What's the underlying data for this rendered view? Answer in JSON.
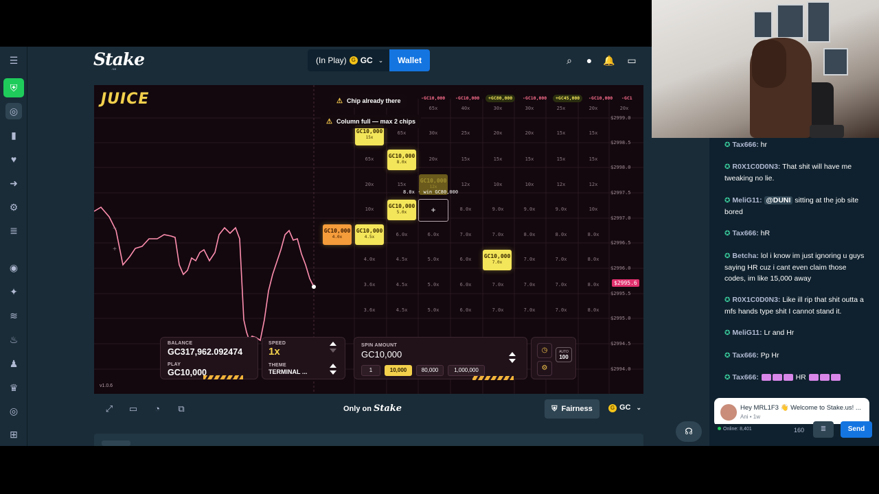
{
  "header": {
    "logo": "Stake",
    "logo_sub": ".us",
    "in_play_label": "(In Play)",
    "currency": "GC",
    "wallet_label": "Wallet"
  },
  "game": {
    "title": "JUICE",
    "version": "v1.0.6",
    "toasts": [
      "Chip already there",
      "Column full — max 2 chips"
    ],
    "hover_win_label": "8.0x · win GC80,000",
    "selected_symbol": "+",
    "trade_pills": [
      "-GC10,000",
      "-GC10,000",
      "+GC80,000",
      "-GC10,000",
      "+GC45,000",
      "-GC10,000",
      "-GC1"
    ],
    "trade_pill_colors": [
      "#ff6f8f",
      "#ff6f8f",
      "#f4e65a",
      "#ff6f8f",
      "#f4e65a",
      "#ff6f8f",
      "#ff6f8f"
    ],
    "prices": [
      "$2999.0",
      "$2998.5",
      "$2998.0",
      "$2997.5",
      "$2997.0",
      "$2996.5",
      "$2996.0",
      "$2995.5",
      "$2995.0",
      "$2994.5",
      "$2994.0"
    ],
    "current_price": "$2995.6",
    "multiplier_rows": [
      [
        "65x",
        "40x",
        "30x",
        "30x",
        "25x",
        "20x",
        "20x"
      ],
      [
        "65x",
        "30x",
        "25x",
        "20x",
        "20x",
        "15x",
        "15x"
      ],
      [
        "65x",
        "20x",
        "15x",
        "15x",
        "15x",
        "15x",
        "15x"
      ],
      [
        "20x",
        "15x",
        "12x",
        "12x",
        "10x",
        "10x",
        "12x"
      ],
      [
        "10x",
        "8.0x",
        "8.0x",
        "9.0x",
        "9.0x",
        "9.0x",
        "10x"
      ],
      [
        "6.0x",
        "6.0x",
        "7.0x",
        "7.0x",
        "8.0x",
        "8.0x",
        "8.0x"
      ],
      [
        "4.0x",
        "4.5x",
        "5.0x",
        "6.0x",
        "7.0x",
        "7.0x",
        "8.0x"
      ],
      [
        "3.6x",
        "4.5x",
        "5.0x",
        "6.0x",
        "7.0x",
        "7.0x",
        "8.0x"
      ],
      [
        "3.6x",
        "4.5x",
        "5.0x",
        "6.0x",
        "7.0x",
        "7.0x",
        "8.0x"
      ]
    ],
    "chips": [
      {
        "amount": "GC10,000",
        "mult": "15x",
        "style": "yellow"
      },
      {
        "amount": "GC10,000",
        "mult": "8.0x",
        "style": "yellow"
      },
      {
        "amount": "GC10,000",
        "mult": "12x",
        "style": "ghost"
      },
      {
        "amount": "GC10,000",
        "mult": "5.0x",
        "style": "yellow"
      },
      {
        "amount": "GC10,000",
        "mult": "4.0x",
        "style": "orange"
      },
      {
        "amount": "GC10,000",
        "mult": "4.5x",
        "style": "yellow"
      },
      {
        "amount": "GC10,000",
        "mult": "7.0x",
        "style": "yellow"
      }
    ],
    "controls": {
      "balance_label": "BALANCE",
      "balance": "GC317,962.092474",
      "play_label": "PLAY",
      "play": "GC10,000",
      "speed_label": "SPEED",
      "speed": "1x",
      "theme_label": "THEME",
      "theme": "TERMINAL ...",
      "spin_amount_label": "SPIN AMOUNT",
      "spin_amount": "GC10,000",
      "presets": [
        "1",
        "10,000",
        "80,000",
        "1,000,000"
      ],
      "auto_label": "AUTO",
      "auto_value": "100"
    }
  },
  "footer": {
    "only_on": "Only on",
    "brand": "Stake",
    "fairness": "Fairness",
    "currency": "GC"
  },
  "chat": {
    "messages": [
      {
        "user": "Tax666:",
        "text": "hr"
      },
      {
        "user": "R0X1C0D0N3:",
        "text": "That shit will have me tweaking no lie."
      },
      {
        "user": "MeliG11:",
        "mention": "@DUNI",
        "text": "sitting at the job site bored"
      },
      {
        "user": "Tax666:",
        "text": "hR"
      },
      {
        "user": "Betcha:",
        "text": "lol i know im just ignoring u guys saying HR cuz i cant even claim those codes, im like 15,000 away"
      },
      {
        "user": "R0X1C0D0N3:",
        "text": "Like ill rip that shit outta a mfs hands type shit I cannot stand it."
      },
      {
        "user": "MeliG11:",
        "text": "Lr and Hr"
      },
      {
        "user": "Tax666:",
        "text": "Pp Hr"
      },
      {
        "user": "Tax666:",
        "text": "HR"
      }
    ],
    "popup_text": "Hey MRL1F3 👋 Welcome to Stake.us! ...",
    "popup_meta": "Ani • 1w",
    "online": "Online: 8,401",
    "char_count": "160",
    "send": "Send"
  }
}
